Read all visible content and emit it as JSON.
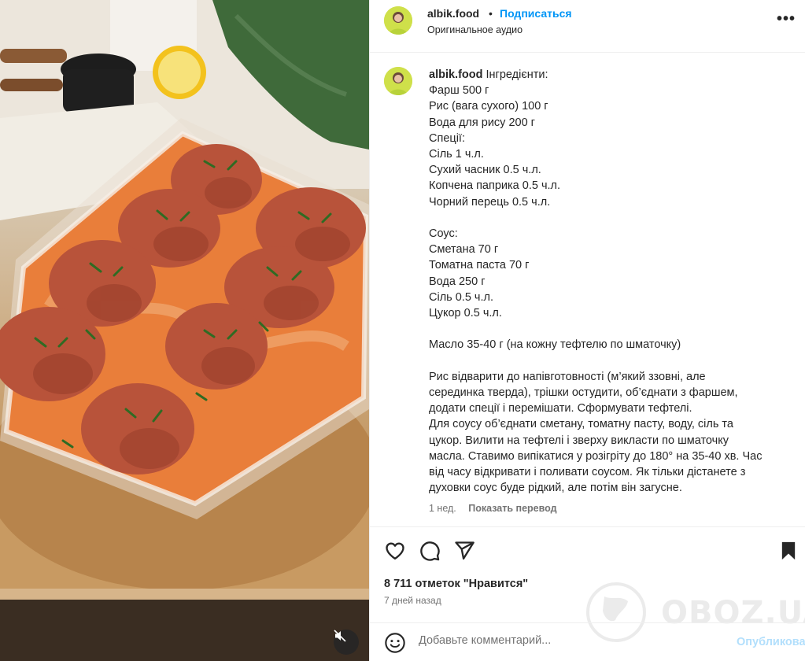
{
  "post": {
    "username": "albik.food",
    "separator": "•",
    "follow_label": "Подписаться",
    "audio_label": "Оригинальное аудио",
    "more_label": "•••"
  },
  "caption": {
    "username": "albik.food",
    "first_line": "Інгредієнти:",
    "lines": [
      "Фарш 500 г",
      "Рис (вага сухого) 100 г",
      "Вода для рису 200 г",
      "Спеції:",
      "Сіль 1 ч.л.",
      "Сухий часник 0.5 ч.л.",
      "Копчена паприка 0.5 ч.л.",
      "Чорний перець 0.5 ч.л.",
      "",
      "Соус:",
      "Сметана 70 г",
      "Томатна паста 70 г",
      "Вода 250 г",
      "Сіль 0.5 ч.л.",
      "Цукор 0.5 ч.л.",
      "",
      "Масло 35-40 г (на кожну тефтелю по шматочку)",
      "",
      "Рис відварити до напівготовності (м’який ззовні, але",
      "серединка тверда), трішки остудити, об’єднати з фаршем,",
      "додати спеції і перемішати. Сформувати тефтелі.",
      "Для соусу об’єднати сметану, томатну пасту, воду, сіль та",
      "цукор. Вилити на тефтелі і зверху викласти по шматочку",
      "масла. Ставимо випікатися у розігріту до 180° на 35-40 хв. Час",
      "від часу відкривати і поливати соусом. Як тільки дістанете з",
      "духовки соус буде рідкий, але потім він загусне."
    ],
    "time_label": "1 нед.",
    "translate_label": "Показать перевод"
  },
  "stats": {
    "likes_label": "8 711 отметок \"Нравится\"",
    "date_label": "7 дней назад"
  },
  "comment": {
    "placeholder": "Добавьте комментарий...",
    "publish_label": "Опубликовать"
  },
  "watermark": {
    "text": "OBOZ.UA"
  },
  "icons": {
    "like": "heart-icon",
    "comment": "comment-bubble-icon",
    "share": "paper-plane-icon",
    "save": "bookmark-icon",
    "emoji": "smiley-icon",
    "mute": "speaker-muted-icon"
  },
  "colors": {
    "link_blue": "#0095f6",
    "publish_disabled": "#b2dffc",
    "text": "#262626",
    "muted": "#737373"
  }
}
